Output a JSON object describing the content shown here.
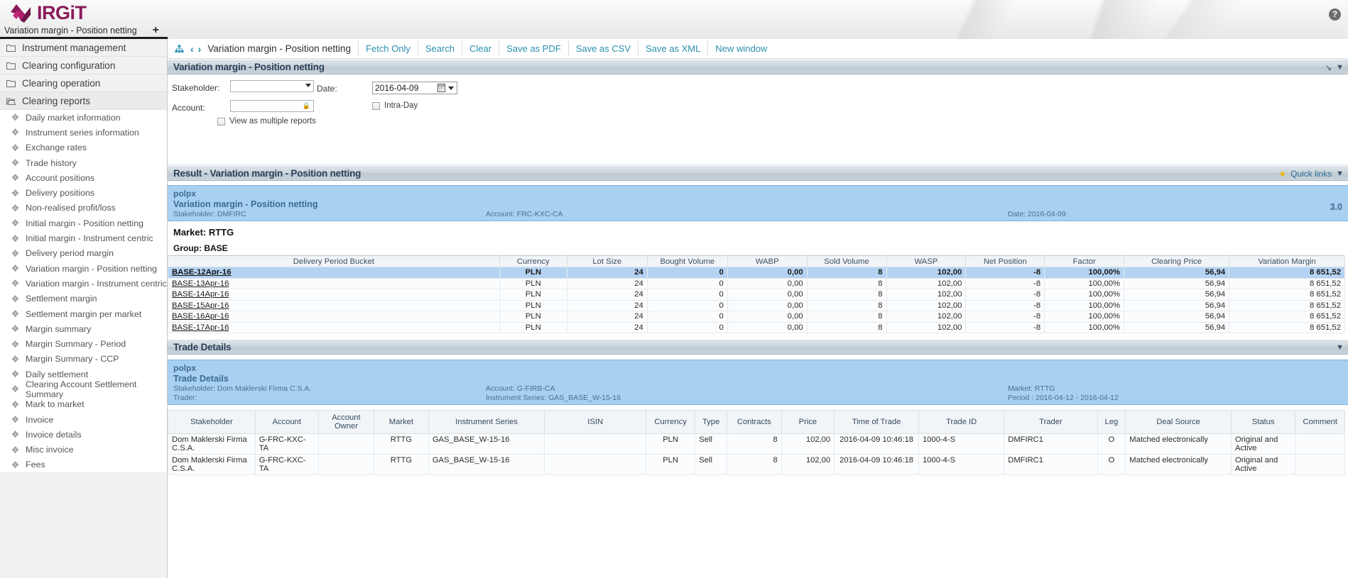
{
  "app": {
    "brand": "IRGiT",
    "help_icon": "help-icon",
    "tab_label": "Variation margin - Position netting",
    "add_tab_label": "+"
  },
  "sidebar": {
    "groups": [
      {
        "label": "Instrument management",
        "icon": "folder-icon",
        "open": false
      },
      {
        "label": "Clearing configuration",
        "icon": "folder-icon",
        "open": false
      },
      {
        "label": "Clearing operation",
        "icon": "folder-icon",
        "open": false
      },
      {
        "label": "Clearing reports",
        "icon": "folder-open-icon",
        "open": true
      }
    ],
    "items": [
      "Daily market information",
      "Instrument series information",
      "Exchange rates",
      "Trade history",
      "Account positions",
      "Delivery positions",
      "Non-realised profit/loss",
      "Initial margin - Position netting",
      "Initial margin - Instrument centric",
      "Delivery period margin",
      "Variation margin - Position netting",
      "Variation margin - Instrument centric",
      "Settlement margin",
      "Settlement margin per market",
      "Margin summary",
      "Margin Summary - Period",
      "Margin Summary - CCP",
      "Daily settlement",
      "Clearing Account Settlement Summary",
      "Mark to market",
      "Invoice",
      "Invoice details",
      "Misc invoice",
      "Fees"
    ]
  },
  "breadcrumb": {
    "home_icon": "sitemap-icon",
    "prev_icon": "chevron-left-icon",
    "next_icon": "chevron-right-icon",
    "title": "Variation margin - Position netting",
    "links": [
      "Fetch Only",
      "Search",
      "Clear",
      "Save as PDF",
      "Save as CSV",
      "Save as XML",
      "New window"
    ]
  },
  "search_panel": {
    "title": "Variation margin - Position netting",
    "stakeholder_label": "Stakeholder:",
    "stakeholder_value": "",
    "account_label": "Account:",
    "account_value": "",
    "date_label": "Date:",
    "date_value": "2016-04-09",
    "intraday_label": "Intra-Day",
    "intraday_checked": false,
    "multi_label": "View as multiple reports",
    "multi_checked": false
  },
  "result_panel": {
    "title": "Result - Variation margin - Position netting",
    "quick_links_label": "Quick links",
    "report": {
      "source": "polpx",
      "name": "Variation margin - Position netting",
      "stakeholder": "Stakeholder: DMFIRC",
      "account": "Account: FRC-KXC-CA",
      "date": "Date: 2016-04-09",
      "version": "3.0"
    },
    "market": "Market: RTTG",
    "group": "Group: BASE",
    "columns": [
      "Delivery Period Bucket",
      "Currency",
      "Lot Size",
      "Bought Volume",
      "WABP",
      "Sold Volume",
      "WASP",
      "Net Position",
      "Factor",
      "Clearing Price",
      "Variation Margin"
    ],
    "rows": [
      {
        "bucket": "BASE-12Apr-16",
        "currency": "PLN",
        "lot": "24",
        "bought": "0",
        "wabp": "0,00",
        "sold": "8",
        "wasp": "102,00",
        "net": "-8",
        "factor": "100,00%",
        "clearing": "56,94",
        "margin": "8 651,52",
        "selected": true
      },
      {
        "bucket": "BASE-13Apr-16",
        "currency": "PLN",
        "lot": "24",
        "bought": "0",
        "wabp": "0,00",
        "sold": "8",
        "wasp": "102,00",
        "net": "-8",
        "factor": "100,00%",
        "clearing": "56,94",
        "margin": "8 651,52",
        "selected": false
      },
      {
        "bucket": "BASE-14Apr-16",
        "currency": "PLN",
        "lot": "24",
        "bought": "0",
        "wabp": "0,00",
        "sold": "8",
        "wasp": "102,00",
        "net": "-8",
        "factor": "100,00%",
        "clearing": "56,94",
        "margin": "8 651,52",
        "selected": false
      },
      {
        "bucket": "BASE-15Apr-16",
        "currency": "PLN",
        "lot": "24",
        "bought": "0",
        "wabp": "0,00",
        "sold": "8",
        "wasp": "102,00",
        "net": "-8",
        "factor": "100,00%",
        "clearing": "56,94",
        "margin": "8 651,52",
        "selected": false
      },
      {
        "bucket": "BASE-16Apr-16",
        "currency": "PLN",
        "lot": "24",
        "bought": "0",
        "wabp": "0,00",
        "sold": "8",
        "wasp": "102,00",
        "net": "-8",
        "factor": "100,00%",
        "clearing": "56,94",
        "margin": "8 651,52",
        "selected": false
      },
      {
        "bucket": "BASE-17Apr-16",
        "currency": "PLN",
        "lot": "24",
        "bought": "0",
        "wabp": "0,00",
        "sold": "8",
        "wasp": "102,00",
        "net": "-8",
        "factor": "100,00%",
        "clearing": "56,94",
        "margin": "8 651,52",
        "selected": false
      }
    ]
  },
  "trade_panel": {
    "title": "Trade Details",
    "report": {
      "source": "polpx",
      "name": "Trade Details",
      "stakeholder": "Stakeholder: Dom Maklerski Firma C.S.A.",
      "trader": "Trader:",
      "account": "Account: G-FIRB-CA",
      "instrument_series": "Instrument Series: GAS_BASE_W-15-16",
      "market": "Market: RTTG",
      "period": "Period : 2016-04-12 - 2016-04-12"
    },
    "columns": [
      "Stakeholder",
      "Account",
      "Account Owner",
      "Market",
      "Instrument Series",
      "ISIN",
      "Currency",
      "Type",
      "Contracts",
      "Price",
      "Time of Trade",
      "Trade ID",
      "Trader",
      "Leg",
      "Deal Source",
      "Status",
      "Comment"
    ],
    "rows": [
      {
        "stakeholder": "Dom Maklerski Firma C.S.A.",
        "account": "G-FRC-KXC-TA",
        "owner": "",
        "market": "RTTG",
        "series": "GAS_BASE_W-15-16",
        "isin": "",
        "currency": "PLN",
        "type": "Sell",
        "contracts": "8",
        "price": "102,00",
        "time": "2016-04-09 10:46:18",
        "trade_id": "1000-4-S",
        "trader": "DMFIRC1",
        "leg": "O",
        "source": "Matched electronically",
        "status": "Original and Active",
        "comment": ""
      },
      {
        "stakeholder": "Dom Maklerski Firma C.S.A.",
        "account": "G-FRC-KXC-TA",
        "owner": "",
        "market": "RTTG",
        "series": "GAS_BASE_W-15-16",
        "isin": "",
        "currency": "PLN",
        "type": "Sell",
        "contracts": "8",
        "price": "102,00",
        "time": "2016-04-09 10:46:18",
        "trade_id": "1000-4-S",
        "trader": "DMFIRC1",
        "leg": "O",
        "source": "Matched electronically",
        "status": "Original and Active",
        "comment": ""
      }
    ]
  },
  "colors": {
    "brand": "#8a1a5a",
    "link": "#2a8fae",
    "panel_title": "#2b3f57",
    "band": "#a8d0f0",
    "selected_row": "#b4d3f2"
  }
}
